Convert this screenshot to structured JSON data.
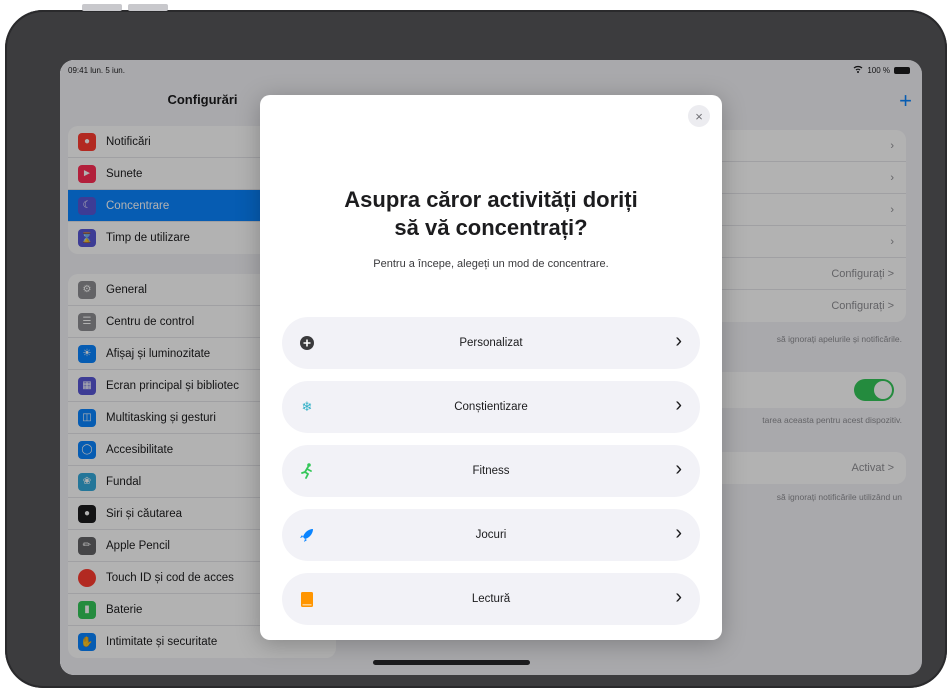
{
  "status_bar": {
    "time": "09:41 lun. 5 iun.",
    "battery": "100 %"
  },
  "sidebar": {
    "title": "Configurări",
    "group1": [
      {
        "label": "Notificări",
        "icon": "bell-icon",
        "color": "#ff3b30"
      },
      {
        "label": "Sunete",
        "icon": "speaker-icon",
        "color": "#ff2d55"
      },
      {
        "label": "Concentrare",
        "icon": "moon-icon",
        "color": "#5856d6",
        "selected": true
      },
      {
        "label": "Timp de utilizare",
        "icon": "hourglass-icon",
        "color": "#5856d6"
      }
    ],
    "group2": [
      {
        "label": "General",
        "icon": "gear-icon",
        "color": "#8e8e93"
      },
      {
        "label": "Centru de control",
        "icon": "switches-icon",
        "color": "#8e8e93"
      },
      {
        "label": "Afișaj și luminozitate",
        "icon": "sun-icon",
        "color": "#0a84ff"
      },
      {
        "label": "Ecran principal și bibliotec",
        "icon": "grid-icon",
        "color": "#5856d6"
      },
      {
        "label": "Multitasking și gesturi",
        "icon": "multitasking-icon",
        "color": "#0a84ff"
      },
      {
        "label": "Accesibilitate",
        "icon": "accessibility-icon",
        "color": "#0a84ff"
      },
      {
        "label": "Fundal",
        "icon": "flower-icon",
        "color": "#34aadc"
      },
      {
        "label": "Siri și căutarea",
        "icon": "siri-icon",
        "color": "#1c1c1e"
      },
      {
        "label": "Apple Pencil",
        "icon": "pencil-icon",
        "color": "#636366"
      },
      {
        "label": "Touch ID și cod de acces",
        "icon": "fingerprint-icon",
        "color": "#ff3b30"
      },
      {
        "label": "Baterie",
        "icon": "battery-icon",
        "color": "#34c759"
      },
      {
        "label": "Intimitate și securitate",
        "icon": "hand-icon",
        "color": "#0a84ff"
      }
    ]
  },
  "right_pane": {
    "configure_1": "Configurați >",
    "configure_2": "Configurați >",
    "note_1": "să ignorați apelurile și notificările.",
    "note_2": "tarea aceasta pentru acest dispozitiv.",
    "activated": "Activat >",
    "note_3": "să ignorați notificările utilizând un"
  },
  "modal": {
    "close": "×",
    "title_line1": "Asupra căror activități doriți",
    "title_line2": "să vă concentrați?",
    "subtitle": "Pentru a începe, alegeți un mod de concentrare.",
    "options": [
      {
        "label": "Personalizat",
        "icon": "plus-circle-icon",
        "color": "#3a3a3c"
      },
      {
        "label": "Conștientizare",
        "icon": "snowflake-icon",
        "color": "#30b0c7"
      },
      {
        "label": "Fitness",
        "icon": "runner-icon",
        "color": "#34c759"
      },
      {
        "label": "Jocuri",
        "icon": "rocket-icon",
        "color": "#0a84ff"
      },
      {
        "label": "Lectură",
        "icon": "book-icon",
        "color": "#ff9500"
      }
    ]
  }
}
